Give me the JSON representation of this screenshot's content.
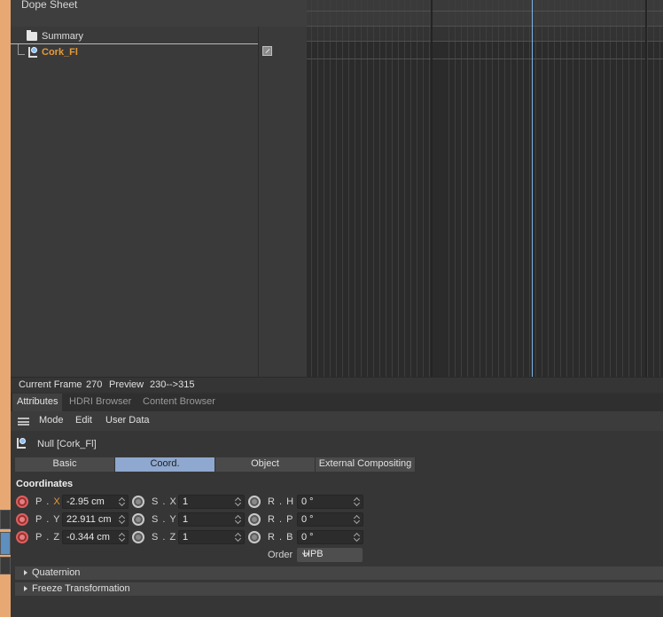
{
  "dope_sheet": {
    "title": "Dope Sheet",
    "tree": {
      "summary_label": "Summary",
      "object_label": "Cork_Fl"
    }
  },
  "status": {
    "current_frame_label": "Current Frame",
    "current_frame_value": "270",
    "preview_label": "Preview",
    "preview_value": "230-->315"
  },
  "panel_tabs": [
    "Attributes",
    "HDRI Browser",
    "Content Browser"
  ],
  "attributes": {
    "menu": [
      "Mode",
      "Edit",
      "User Data"
    ],
    "object_title": "Null [Cork_Fl]",
    "property_tabs": [
      "Basic",
      "Coord.",
      "Object",
      "External Compositing"
    ],
    "selected_tab": "Coord.",
    "section_title": "Coordinates",
    "position": {
      "x_label": "P",
      "x_axis": "X",
      "x_value": "-2.95 cm",
      "y_label": "P",
      "y_axis": "Y",
      "y_value": "22.911 cm",
      "z_label": "P",
      "z_axis": "Z",
      "z_value": "-0.344 cm"
    },
    "scale": {
      "x_label": "S",
      "x_axis": "X",
      "x_value": "1",
      "y_label": "S",
      "y_axis": "Y",
      "y_value": "1",
      "z_label": "S",
      "z_axis": "Z",
      "z_value": "1"
    },
    "rotation": {
      "h_label": "R",
      "h_axis": "H",
      "h_value": "0 °",
      "p_label": "R",
      "p_axis": "P",
      "p_value": "0 °",
      "b_label": "R",
      "b_axis": "B",
      "b_value": "0 °"
    },
    "order_label": "Order",
    "order_value": "HPB",
    "groups": [
      "Quaternion",
      "Freeze Transformation"
    ]
  },
  "colors": {
    "accent_selected_tab": "#8fa8cf",
    "object_name": "#e59a3a",
    "frame_indicator": "#7fb5e8",
    "animated_dot": "#e06060"
  }
}
